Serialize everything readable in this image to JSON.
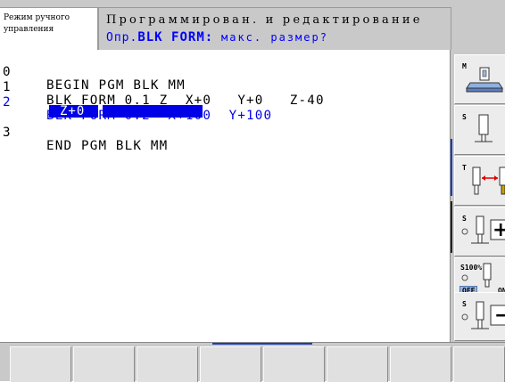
{
  "header": {
    "mode_line1": "Режим ручного",
    "mode_line2": "управления",
    "title": "Программирован. и редактирование",
    "prompt_prefix": "Опр.",
    "prompt_keyword": "BLK FORM:",
    "prompt_suffix": "макс. размер?"
  },
  "program": {
    "lines": [
      {
        "num": "0",
        "code": "BEGIN PGM BLK MM"
      },
      {
        "num": "1",
        "code": "BLK FORM 0.1 Z  X+0   Y+0   Z-40"
      },
      {
        "num": "2",
        "code": "BLK FORM 0.2  X+100  Y+100"
      },
      {
        "num": "3",
        "code": "END PGM BLK MM"
      }
    ],
    "continuation_selected": "Z+0"
  },
  "softkeys_right": [
    {
      "id": "m",
      "label": "M",
      "icon": "machine-table-icon"
    },
    {
      "id": "s",
      "label": "S",
      "icon": "spindle-tool-icon"
    },
    {
      "id": "t",
      "label": "T",
      "icon": "tool-change-icon"
    },
    {
      "id": "s-plus",
      "label": "S",
      "sign": "+",
      "icon": "spindle-plus-icon"
    },
    {
      "id": "s100",
      "label": "S100%",
      "off": "OFF",
      "on": "ON",
      "icon": "spindle-override-icon"
    },
    {
      "id": "s-minus",
      "label": "S",
      "sign": "−",
      "icon": "spindle-minus-icon"
    }
  ],
  "colors": {
    "panel": "#c9c9c9",
    "accent_blue": "#0000e6",
    "highlight": "#0000e6"
  }
}
